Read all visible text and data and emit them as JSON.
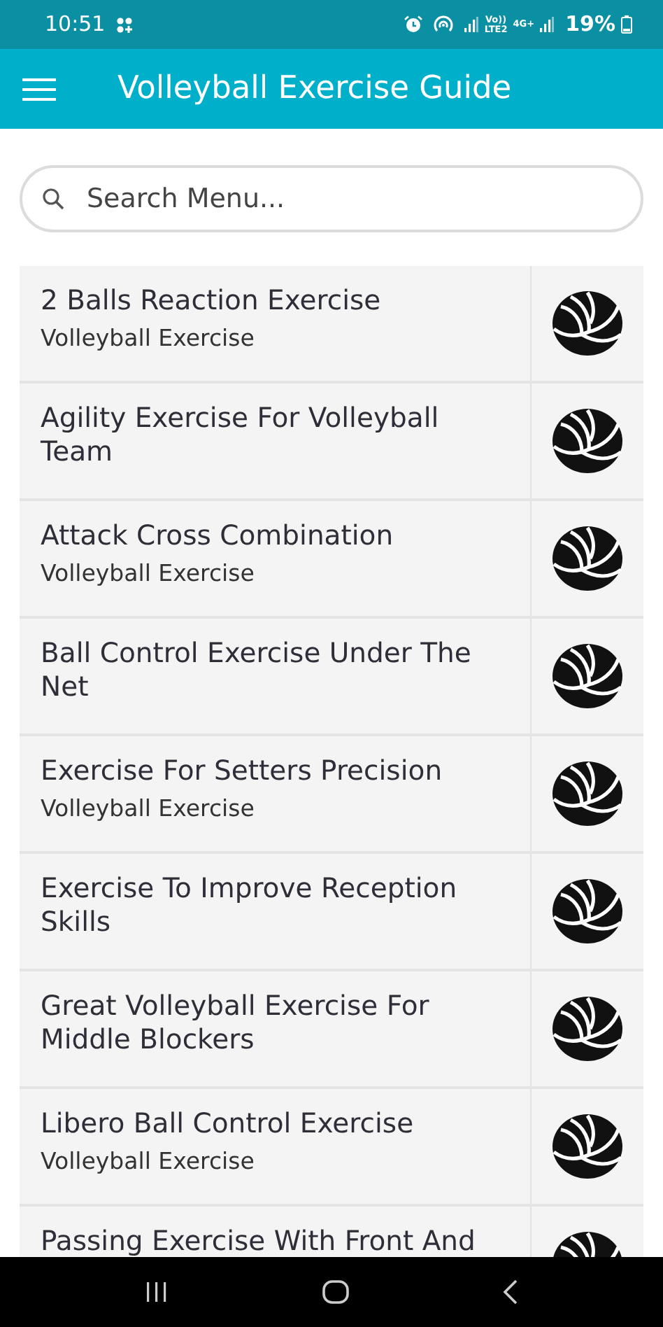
{
  "status_bar": {
    "time": "10:51",
    "volte": "Vo))",
    "lte": "LTE2",
    "network": "4G+",
    "battery": "19%"
  },
  "app_bar": {
    "title": "Volleyball Exercise Guide"
  },
  "search": {
    "placeholder": "Search Menu..."
  },
  "items": [
    {
      "title": "2 Balls Reaction Exercise",
      "subtitle": "Volleyball Exercise"
    },
    {
      "title": "Agility Exercise For Volleyball Team"
    },
    {
      "title": "Attack Cross Combination",
      "subtitle": "Volleyball Exercise"
    },
    {
      "title": "Ball Control Exercise Under The Net"
    },
    {
      "title": "Exercise For Setters Precision",
      "subtitle": "Volleyball Exercise"
    },
    {
      "title": "Exercise To Improve Reception Skills"
    },
    {
      "title": "Great Volleyball Exercise For Middle Blockers"
    },
    {
      "title": "Libero Ball Control Exercise",
      "subtitle": "Volleyball Exercise"
    },
    {
      "title": "Passing Exercise With Front And"
    }
  ]
}
